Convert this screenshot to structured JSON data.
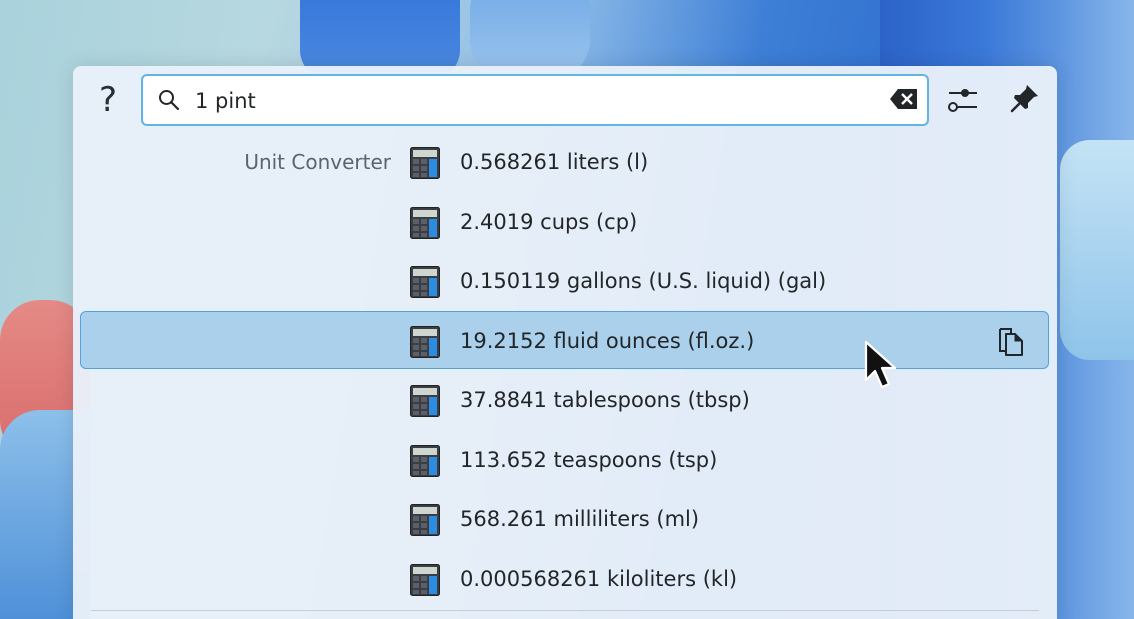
{
  "search": {
    "help_label": "?",
    "query": "1 pint",
    "icons": {
      "search": "search-icon",
      "clear": "backspace-clear-icon",
      "settings": "settings-sliders-icon",
      "pin": "pin-icon"
    }
  },
  "results": {
    "category": "Unit Converter",
    "icon": "calculator-icon",
    "selected_index": 3,
    "items": [
      {
        "label": "0.568261 liters (l)"
      },
      {
        "label": "2.4019 cups (cp)"
      },
      {
        "label": "0.150119 gallons (U.S. liquid) (gal)"
      },
      {
        "label": "19.2152 fluid ounces (fl.oz.)"
      },
      {
        "label": "37.8841 tablespoons (tbsp)"
      },
      {
        "label": "113.652 teaspoons (tsp)"
      },
      {
        "label": "568.261 milliliters (ml)"
      },
      {
        "label": "0.000568261 kiloliters (kl)"
      }
    ],
    "action_icon": "copy-icon"
  },
  "colors": {
    "accent": "#61b5e3",
    "selected_bg": "#aad0ec",
    "selected_border": "#4fa3df"
  }
}
